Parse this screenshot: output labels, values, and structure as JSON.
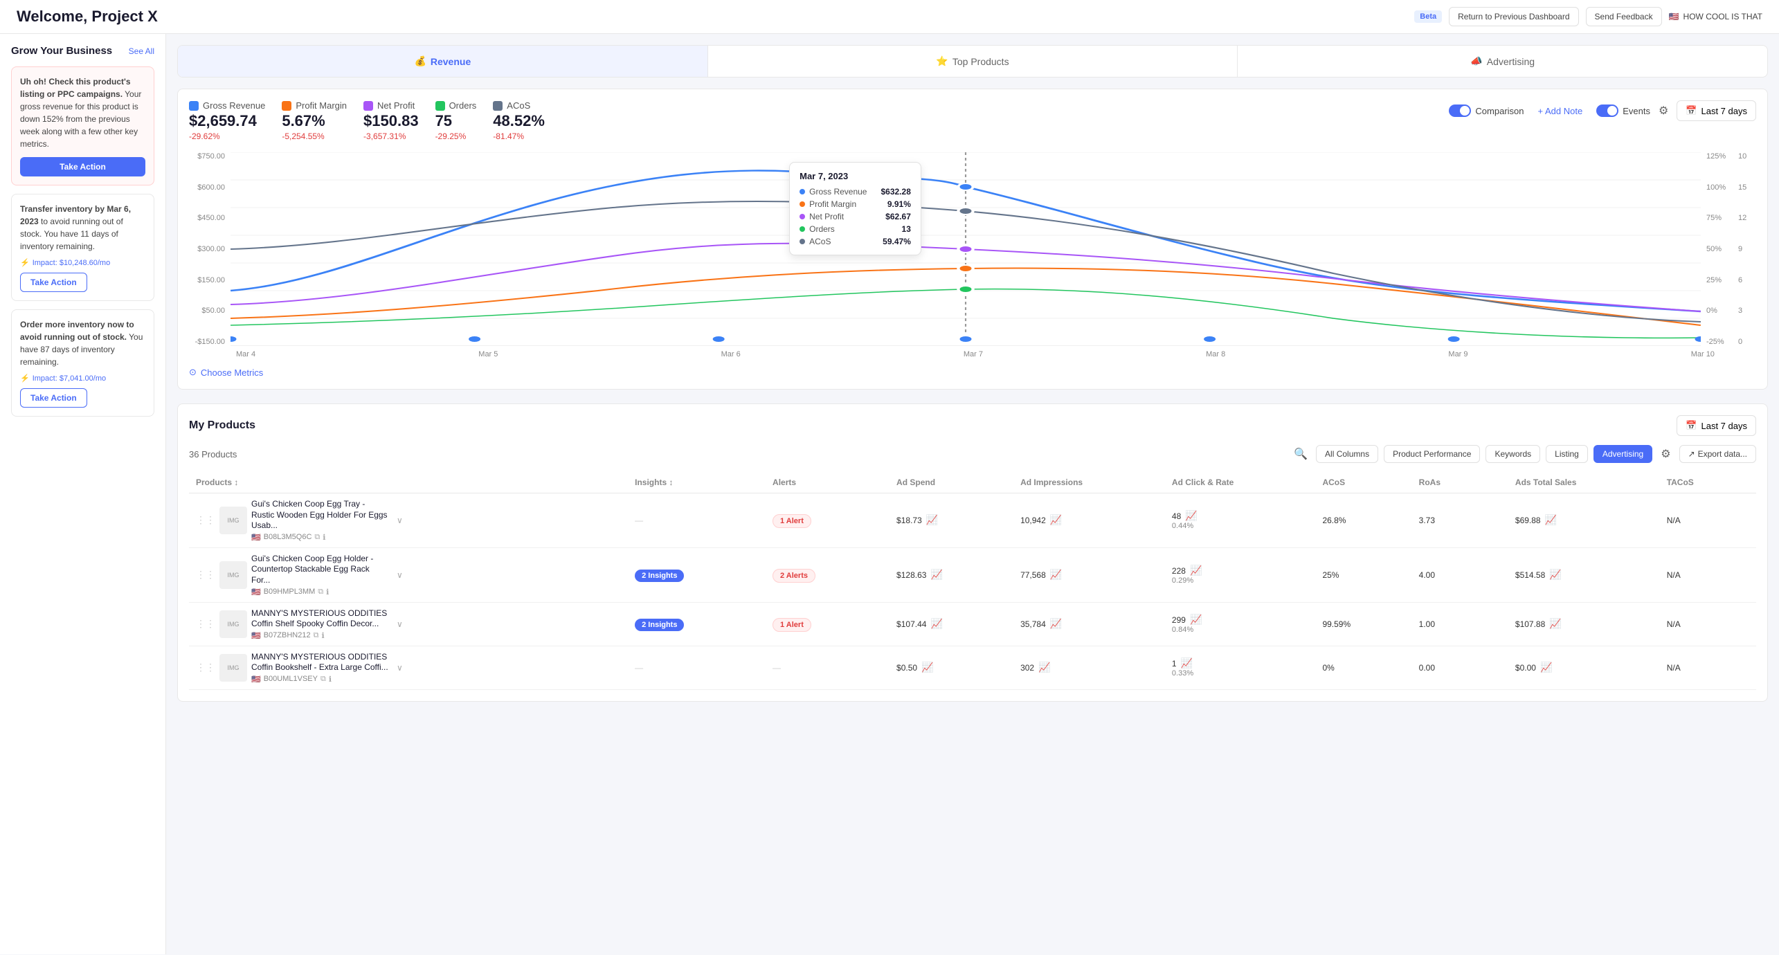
{
  "header": {
    "title": "Welcome, Project X",
    "beta_label": "Beta",
    "btn_return": "Return to Previous Dashboard",
    "btn_feedback": "Send Feedback",
    "flag": "🇺🇸",
    "user_label": "HOW COOL IS THAT"
  },
  "sidebar": {
    "title": "Grow Your Business",
    "see_all": "See All",
    "alert1": {
      "text_bold": "Uh oh! Check this product's listing or PPC campaigns.",
      "text_body": " Your gross revenue for this product is down 152% from the previous week along with a few other key metrics.",
      "btn": "Take Action"
    },
    "action1": {
      "text_bold": "Transfer inventory by Mar 6, 2023",
      "text_body": " to avoid running out of stock. You have 11 days of inventory remaining.",
      "impact": "Impact: $10,248.60/mo",
      "btn": "Take Action"
    },
    "action2": {
      "text_bold": "Order more inventory now to avoid running out of stock.",
      "text_body": " You have 87 days of inventory remaining.",
      "impact": "Impact: $7,041.00/mo",
      "btn": "Take Action"
    }
  },
  "revenue_tabs": [
    {
      "label": "Revenue",
      "icon": "💰",
      "active": true
    },
    {
      "label": "Top Products",
      "icon": "⭐",
      "active": false
    },
    {
      "label": "Advertising",
      "icon": "📣",
      "active": false
    }
  ],
  "chart": {
    "comparison_label": "Comparison",
    "add_note": "+ Add Note",
    "events_label": "Events",
    "date_range": "Last 7 days",
    "choose_metrics": "Choose Metrics",
    "metrics": [
      {
        "label": "Gross Revenue",
        "value": "$2,659.74",
        "change": "-29.62%",
        "direction": "down",
        "color": "#3b82f6"
      },
      {
        "label": "Profit Margin",
        "value": "5.67%",
        "change": "-5,254.55%",
        "direction": "down",
        "color": "#f97316"
      },
      {
        "label": "Net Profit",
        "value": "$150.83",
        "change": "-3,657.31%",
        "direction": "down",
        "color": "#a855f7"
      },
      {
        "label": "Orders",
        "value": "75",
        "change": "-29.25%",
        "direction": "down",
        "color": "#22c55e"
      },
      {
        "label": "ACoS",
        "value": "48.52%",
        "change": "-81.47%",
        "direction": "down",
        "color": "#64748b"
      }
    ],
    "tooltip": {
      "date": "Mar 7, 2023",
      "rows": [
        {
          "label": "Gross Revenue",
          "value": "$632.28",
          "color": "#3b82f6"
        },
        {
          "label": "Profit Margin",
          "value": "9.91%",
          "color": "#f97316"
        },
        {
          "label": "Net Profit",
          "value": "$62.67",
          "color": "#a855f7"
        },
        {
          "label": "Orders",
          "value": "13",
          "color": "#22c55e"
        },
        {
          "label": "ACoS",
          "value": "59.47%",
          "color": "#64748b"
        }
      ]
    },
    "x_labels": [
      "Mar 4",
      "Mar 5",
      "Mar 6",
      "Mar 7",
      "Mar 8",
      "Mar 9",
      "Mar 10"
    ],
    "y_labels_left": [
      "$750.00",
      "$600.00",
      "$450.00",
      "$300.00",
      "$150.00",
      "$50.00",
      "-$150.00"
    ],
    "y_labels_right": [
      "125%",
      "100%",
      "75%",
      "50%",
      "25%",
      "0%",
      "-25%"
    ],
    "y_labels_right2": [
      "10",
      "15",
      "12",
      "9",
      "6",
      "3",
      "0"
    ]
  },
  "products": {
    "section_title": "My Products",
    "date_range": "Last 7 days",
    "count": "36 Products",
    "columns": {
      "all_columns": "All Columns",
      "product_performance": "Product Performance",
      "keywords": "Keywords",
      "listing": "Listing",
      "advertising": "Advertising"
    },
    "export": "Export data...",
    "table_headers": {
      "products": "Products",
      "insights": "Insights",
      "alerts": "Alerts",
      "ad_spend": "Ad Spend",
      "ad_impressions": "Ad Impressions",
      "ad_click_rate": "Ad Click & Rate",
      "acos": "ACoS",
      "roas": "RoAs",
      "ads_total_sales": "Ads Total Sales",
      "tacos": "TACoS"
    },
    "rows": [
      {
        "name": "Gui's Chicken Coop Egg Tray - Rustic Wooden Egg Holder For Eggs Usab...",
        "asin": "B08L3M5Q6C",
        "flag": "🇺🇸",
        "insights": "—",
        "alerts": "1 Alert",
        "alerts_type": "alert",
        "ad_spend": "$18.73",
        "ad_impressions": "10,942",
        "ad_click": "48",
        "ad_rate": "0.44%",
        "acos": "26.8%",
        "roas": "3.73",
        "ads_total_sales": "$69.88",
        "tacos": "N/A"
      },
      {
        "name": "Gui's Chicken Coop Egg Holder - Countertop Stackable Egg Rack For...",
        "asin": "B09HMPL3MM",
        "flag": "🇺🇸",
        "insights": "2 Insights",
        "alerts": "2 Alerts",
        "alerts_type": "alert",
        "ad_spend": "$128.63",
        "ad_impressions": "77,568",
        "ad_click": "228",
        "ad_rate": "0.29%",
        "acos": "25%",
        "roas": "4.00",
        "ads_total_sales": "$514.58",
        "tacos": "N/A"
      },
      {
        "name": "MANNY'S MYSTERIOUS ODDITIES Coffin Shelf Spooky Coffin Decor...",
        "asin": "B07ZBHN212",
        "flag": "🇺🇸",
        "insights": "2 Insights",
        "alerts": "1 Alert",
        "alerts_type": "alert",
        "ad_spend": "$107.44",
        "ad_impressions": "35,784",
        "ad_click": "299",
        "ad_rate": "0.84%",
        "acos": "99.59%",
        "roas": "1.00",
        "ads_total_sales": "$107.88",
        "tacos": "N/A"
      },
      {
        "name": "MANNY'S MYSTERIOUS ODDITIES Coffin Bookshelf - Extra Large Coffi...",
        "asin": "B00UML1VSEY",
        "flag": "🇺🇸",
        "insights": "—",
        "alerts": "—",
        "alerts_type": "none",
        "ad_spend": "$0.50",
        "ad_impressions": "302",
        "ad_click": "1",
        "ad_rate": "0.33%",
        "acos": "0%",
        "roas": "0.00",
        "ads_total_sales": "$0.00",
        "tacos": "N/A"
      }
    ]
  }
}
